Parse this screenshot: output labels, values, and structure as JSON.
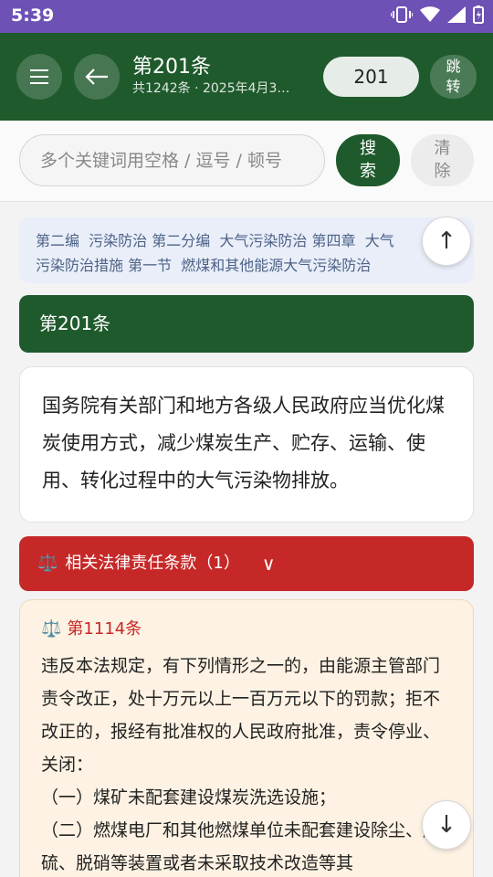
{
  "status_bar": {
    "time": "5:39"
  },
  "app_bar": {
    "title": "第201条",
    "subtitle": "共1242条 · 2025年4月3…",
    "jump_value": "201",
    "jump_label_1": "跳",
    "jump_label_2": "转"
  },
  "search": {
    "placeholder": "多个关键词用空格 / 逗号 / 顿号",
    "search_label_1": "搜",
    "search_label_2": "索",
    "clear_label_1": "清",
    "clear_label_2": "除"
  },
  "breadcrumb": {
    "line1": "第二编  污染防治 第二分编  大气污染防治 第四章  大气",
    "line2": "污染防治措施 第一节  燃煤和其他能源大气污染防治"
  },
  "article": {
    "header": "第201条",
    "body": "国务院有关部门和地方各级人民政府应当优化煤炭使用方式，减少煤炭生产、贮存、运输、使用、转化过程中的大气污染物排放。"
  },
  "liability": {
    "bar_label": "相关法律责任条款（1）",
    "bar_icon": "⚖️",
    "chevron": "∨",
    "ref_title": "第1114条",
    "ref_body_1": "违反本法规定，有下列情形之一的，由能源主管部门责令改正，处十万元以上一百万元以下的罚款；拒不改正的，报经有批准权的人民政府批准，责令停业、关闭：",
    "ref_body_2": "（一）煤矿未配套建设煤炭洗选设施；",
    "ref_body_3": "（二）燃煤电厂和其他燃煤单位未配套建设除尘、脱硫、脱硝等装置或者未采取技术改造等其"
  },
  "fab": {
    "up": "↑",
    "down": "↓"
  },
  "colors": {
    "primary": "#1f5a2c",
    "danger": "#c62828",
    "status": "#6e51b5"
  }
}
